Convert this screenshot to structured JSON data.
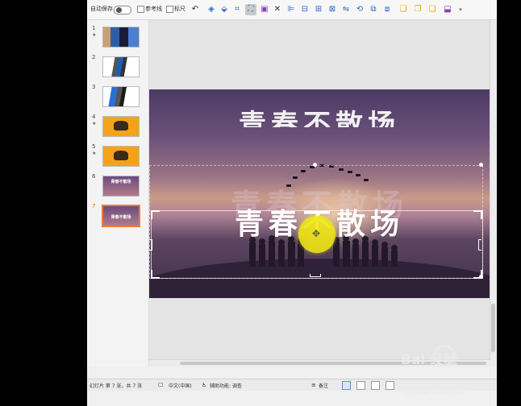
{
  "toolbar": {
    "autosave_label": "自动保存",
    "guides_label": "参考线",
    "ruler_label": "标尺",
    "icons": [
      "undo-icon",
      "shape-icon",
      "align-icon",
      "crop-icon",
      "format-icon",
      "save-icon",
      "close-icon",
      "distribute-icon",
      "group-icon",
      "arrange-icon",
      "layer-icon",
      "flip-icon",
      "rotate-icon",
      "bring-forward-icon",
      "send-backward-icon",
      "select-pane-icon",
      "copy-icon",
      "paste-icon",
      "more-icon"
    ]
  },
  "thumbnails": [
    {
      "num": "1",
      "anim": "★"
    },
    {
      "num": "2",
      "anim": ""
    },
    {
      "num": "3",
      "anim": ""
    },
    {
      "num": "4",
      "anim": "★"
    },
    {
      "num": "5",
      "anim": "★"
    },
    {
      "num": "6",
      "anim": "",
      "label": "青春不散场"
    },
    {
      "num": "7",
      "anim": "",
      "label": "青春不散场",
      "selected": true
    }
  ],
  "slide": {
    "top_title": "青春不散场",
    "ghost_title": "青春不散场",
    "main_title": "青春不散场"
  },
  "status": {
    "slide_info": "幻灯片 第 7 张，共 7 张",
    "language": "中文(中国)",
    "accessibility": "辅助功能: 调查",
    "notes": "备注"
  },
  "watermark": {
    "logo": "Bai 经验",
    "url": "jingyan.baidu.com"
  },
  "colors": {
    "accent": "#f07a3a",
    "cursor_highlight": "#eee614"
  }
}
